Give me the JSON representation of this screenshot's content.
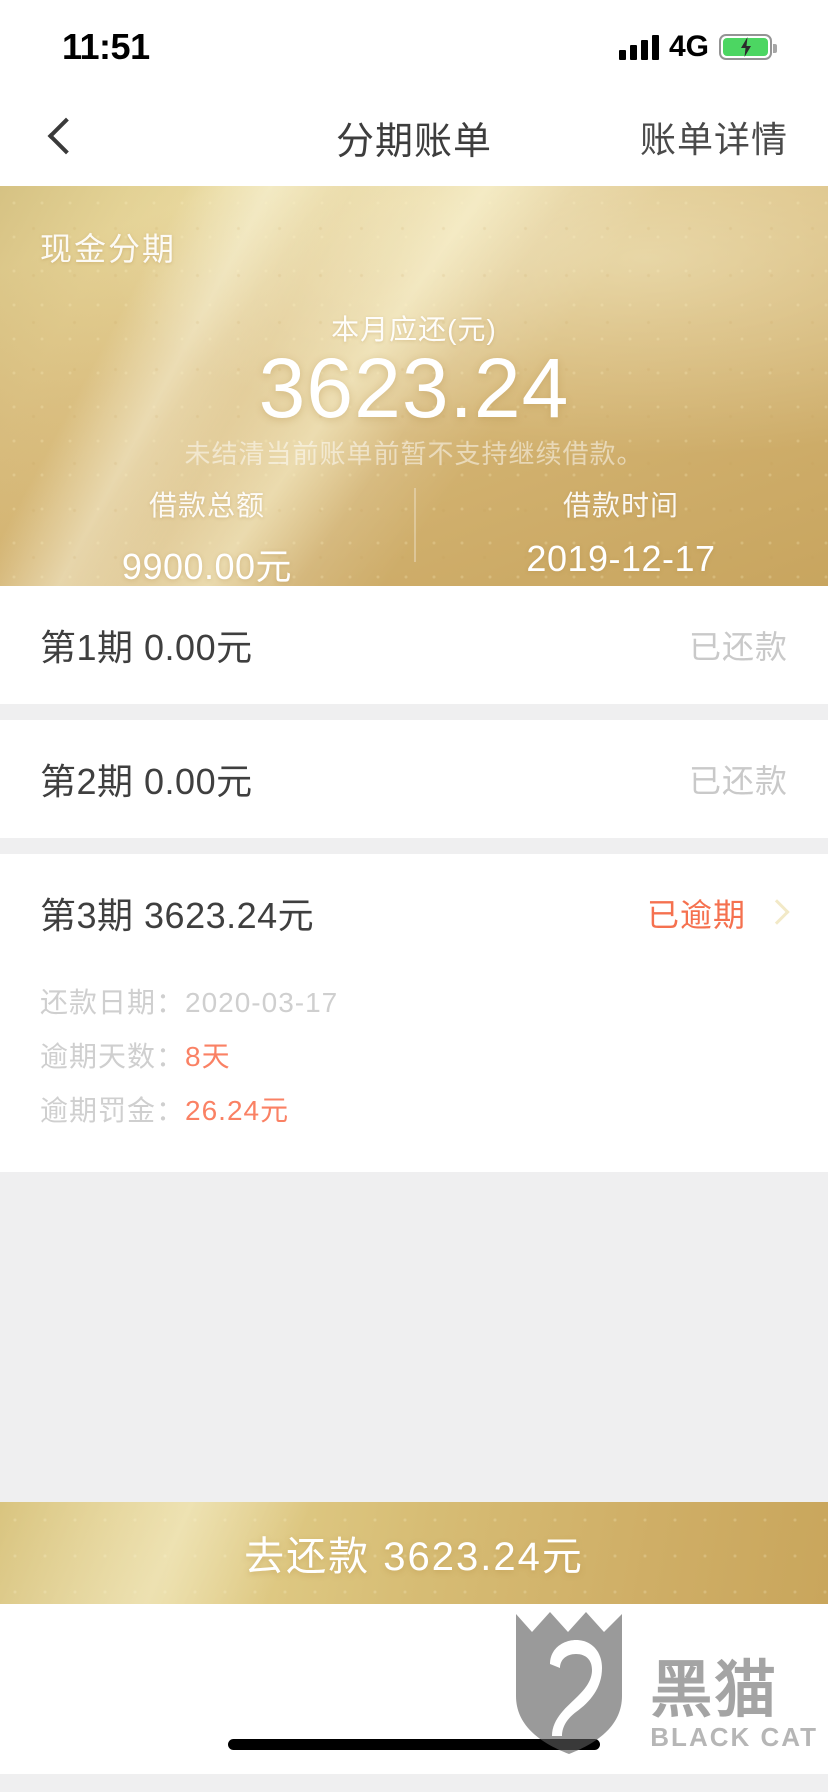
{
  "status_bar": {
    "time": "11:51",
    "carrier": "4G",
    "signal_icon": "signal-bars-icon",
    "battery_icon": "battery-charging-icon"
  },
  "nav": {
    "back_icon": "chevron-left-icon",
    "title": "分期账单",
    "action_label": "账单详情"
  },
  "hero": {
    "tag": "现金分期",
    "due_label": "本月应还(元)",
    "due_amount": "3623.24",
    "note": "未结清当前账单前暂不支持继续借款。",
    "stats": [
      {
        "label": "借款总额",
        "value": "9900.00元"
      },
      {
        "label": "借款时间",
        "value": "2019-12-17"
      }
    ]
  },
  "installments": [
    {
      "title": "第1期 0.00元",
      "status": "已还款",
      "overdue": false,
      "has_chevron": false,
      "details": []
    },
    {
      "title": "第2期 0.00元",
      "status": "已还款",
      "overdue": false,
      "has_chevron": false,
      "details": []
    },
    {
      "title": "第3期 3623.24元",
      "status": "已逾期",
      "overdue": true,
      "has_chevron": true,
      "details": [
        {
          "label": "还款日期：",
          "value": "2020-03-17",
          "warn": false
        },
        {
          "label": "逾期天数：",
          "value": "8天",
          "warn": true
        },
        {
          "label": "逾期罚金：",
          "value": "26.24元",
          "warn": true
        }
      ]
    }
  ],
  "pay_bar": {
    "label": "去还款 3623.24元"
  },
  "watermark": {
    "cn": "黑猫",
    "en": "BLACK CAT",
    "icon": "black-cat-shield-logo"
  },
  "colors": {
    "gold": "#d4b472",
    "gold_light": "#e5d79a",
    "overdue": "#f5714f",
    "muted": "#c9c9c9",
    "page_bg": "#efeff0"
  }
}
